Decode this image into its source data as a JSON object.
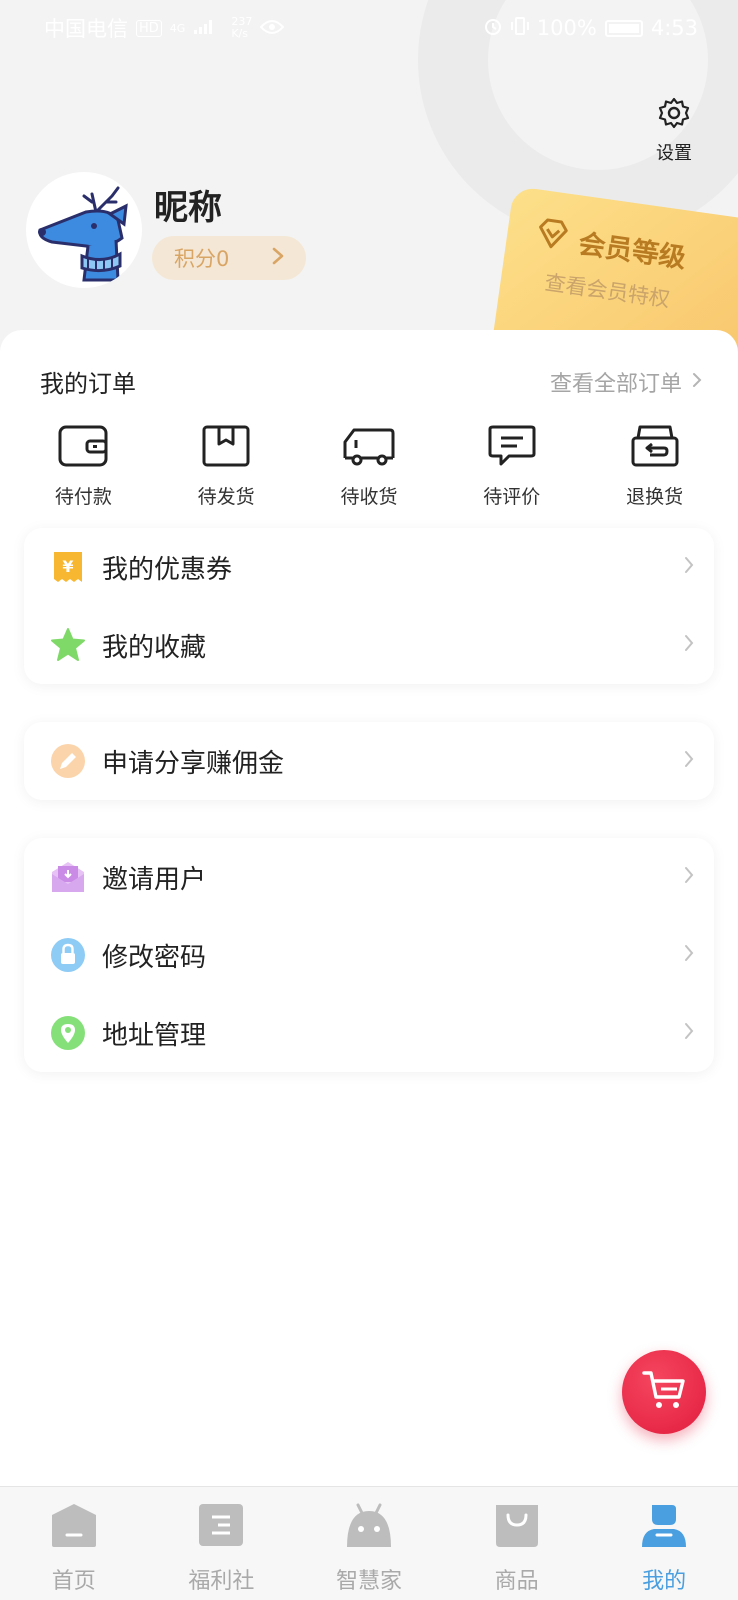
{
  "status_bar": {
    "carrier": "中国电信",
    "hd": "HD",
    "signal": "4G",
    "speed_value": "237",
    "speed_unit": "K/s",
    "battery": "100%",
    "time": "4:53"
  },
  "header": {
    "settings_label": "设置",
    "nickname": "昵称",
    "points_label": "积分0",
    "member_card": {
      "title": "会员等级",
      "subtitle": "查看会员特权"
    }
  },
  "orders": {
    "title": "我的订单",
    "view_all": "查看全部订单",
    "items": [
      {
        "label": "待付款",
        "icon": "wallet-icon"
      },
      {
        "label": "待发货",
        "icon": "box-icon"
      },
      {
        "label": "待收货",
        "icon": "truck-icon"
      },
      {
        "label": "待评价",
        "icon": "comment-icon"
      },
      {
        "label": "退换货",
        "icon": "return-icon"
      }
    ]
  },
  "menu_groups": [
    {
      "items": [
        {
          "label": "我的优惠券",
          "icon": "coupon-icon",
          "color": "#f7b731"
        },
        {
          "label": "我的收藏",
          "icon": "star-icon",
          "color": "#7fd968"
        }
      ]
    },
    {
      "items": [
        {
          "label": "申请分享赚佣金",
          "icon": "pencil-icon",
          "color": "#f6b97a"
        }
      ]
    },
    {
      "items": [
        {
          "label": "邀请用户",
          "icon": "envelope-icon",
          "color": "#c98be6"
        },
        {
          "label": "修改密码",
          "icon": "lock-icon",
          "color": "#6fb6f0"
        },
        {
          "label": "地址管理",
          "icon": "location-icon",
          "color": "#6ad35a"
        }
      ]
    }
  ],
  "tabbar": {
    "items": [
      {
        "label": "首页",
        "icon": "home-icon",
        "active": false
      },
      {
        "label": "福利社",
        "icon": "list-icon",
        "active": false
      },
      {
        "label": "智慧家",
        "icon": "robot-icon",
        "active": false
      },
      {
        "label": "商品",
        "icon": "bag-icon",
        "active": false
      },
      {
        "label": "我的",
        "icon": "profile-icon",
        "active": true
      }
    ],
    "active_color": "#4a9fe0",
    "inactive_color": "#a9a9a9"
  },
  "colors": {
    "accent_blue": "#4a9fe0",
    "cart_red": "#e11d3d",
    "gold": "#f8c56b"
  }
}
